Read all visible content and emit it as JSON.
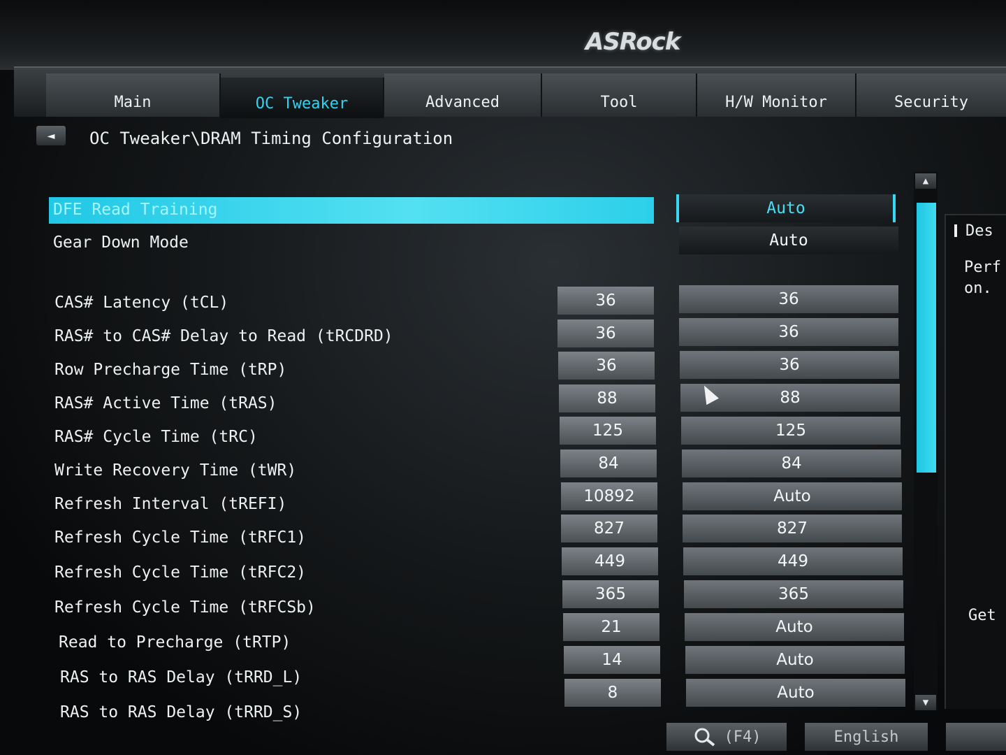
{
  "brand": "ASRock",
  "tabs": [
    {
      "label": "Main"
    },
    {
      "label": "OC Tweaker"
    },
    {
      "label": "Advanced"
    },
    {
      "label": "Tool"
    },
    {
      "label": "H/W Monitor"
    },
    {
      "label": "Security"
    }
  ],
  "back_icon": "◄",
  "breadcrumb": "OC Tweaker\\DRAM Timing Configuration",
  "top_settings": [
    {
      "label": "DFE Read Training",
      "value": "Auto"
    },
    {
      "label": "Gear Down Mode",
      "value": "Auto"
    }
  ],
  "timings": [
    {
      "label": "CAS# Latency (tCL)",
      "current": "36",
      "value": "36"
    },
    {
      "label": "RAS# to CAS# Delay to Read  (tRCDRD)",
      "current": "36",
      "value": "36"
    },
    {
      "label": "Row Precharge Time (tRP)",
      "current": "36",
      "value": "36"
    },
    {
      "label": "RAS# Active Time (tRAS)",
      "current": "88",
      "value": "88"
    },
    {
      "label": "RAS# Cycle Time (tRC)",
      "current": "125",
      "value": "125"
    },
    {
      "label": "Write Recovery Time (tWR)",
      "current": "84",
      "value": "84"
    },
    {
      "label": "Refresh Interval (tREFI)",
      "current": "10892",
      "value": "Auto"
    },
    {
      "label": "Refresh Cycle Time (tRFC1)",
      "current": "827",
      "value": "827"
    },
    {
      "label": "Refresh Cycle Time (tRFC2)",
      "current": "449",
      "value": "449"
    },
    {
      "label": "Refresh Cycle Time (tRFCSb)",
      "current": "365",
      "value": "365"
    },
    {
      "label": "Read to Precharge (tRTP)",
      "current": "21",
      "value": "Auto"
    },
    {
      "label": "RAS to RAS Delay (tRRD_L)",
      "current": "14",
      "value": "Auto"
    },
    {
      "label": "RAS to RAS Delay (tRRD_S)",
      "current": "8",
      "value": "Auto"
    }
  ],
  "scroll": {
    "up_icon": "▲",
    "down_icon": "▼"
  },
  "description": {
    "header": "Des",
    "text": "Perf\non.",
    "footer": "Get"
  },
  "bottom": {
    "search_shortcut": "(F4)",
    "language": "English"
  }
}
